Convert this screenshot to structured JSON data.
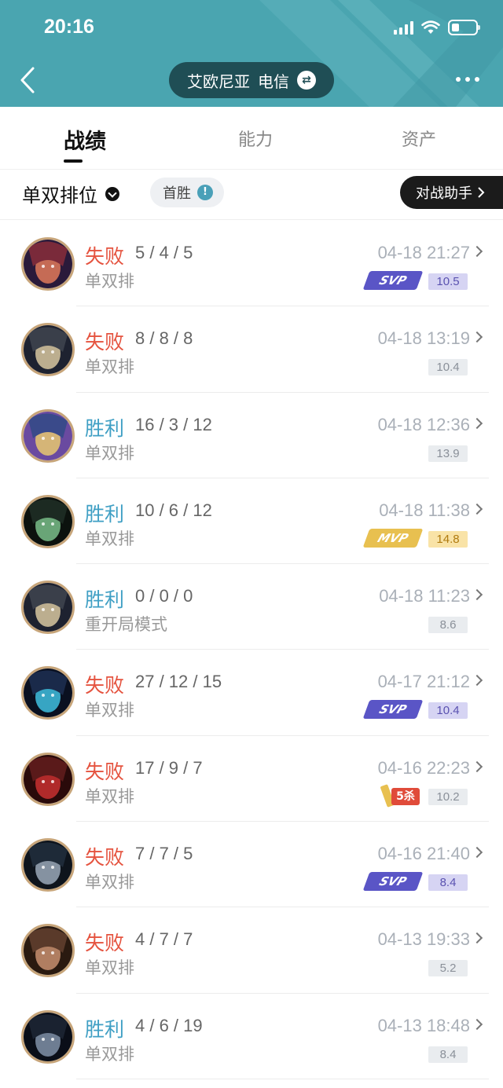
{
  "status_bar": {
    "time": "20:16"
  },
  "header": {
    "region": "艾欧尼亚",
    "isp": "电信"
  },
  "tabs": [
    {
      "label": "战绩",
      "active": true
    },
    {
      "label": "能力",
      "active": false
    },
    {
      "label": "资产",
      "active": false
    }
  ],
  "filter": {
    "queue": "单双排位",
    "first_win": "首胜",
    "assistant": "对战助手"
  },
  "colors": {
    "header_bg": "#4aa5b0",
    "lose": "#e5533f",
    "win": "#3f9fc4",
    "svp": "#5a55c6",
    "mvp": "#e8c050"
  },
  "matches": [
    {
      "result": "失败",
      "kda": "5 / 4 / 5",
      "mode": "单双排",
      "time": "04-18 21:27",
      "badge": "SVP",
      "score": "10.5",
      "avatar": "champion-portrait"
    },
    {
      "result": "失败",
      "kda": "8 / 8 / 8",
      "mode": "单双排",
      "time": "04-18 13:19",
      "badge": "",
      "score": "10.4",
      "avatar": "champion-portrait"
    },
    {
      "result": "胜利",
      "kda": "16 / 3 / 12",
      "mode": "单双排",
      "time": "04-18 12:36",
      "badge": "",
      "score": "13.9",
      "avatar": "champion-portrait"
    },
    {
      "result": "胜利",
      "kda": "10 / 6 / 12",
      "mode": "单双排",
      "time": "04-18 11:38",
      "badge": "MVP",
      "score": "14.8",
      "avatar": "champion-portrait"
    },
    {
      "result": "胜利",
      "kda": "0 / 0 / 0",
      "mode": "重开局模式",
      "time": "04-18 11:23",
      "badge": "",
      "score": "8.6",
      "avatar": "champion-portrait"
    },
    {
      "result": "失败",
      "kda": "27 / 12 / 15",
      "mode": "单双排",
      "time": "04-17 21:12",
      "badge": "SVP",
      "score": "10.4",
      "avatar": "champion-portrait"
    },
    {
      "result": "失败",
      "kda": "17 / 9 / 7",
      "mode": "单双排",
      "time": "04-16 22:23",
      "badge": "5杀",
      "score": "10.2",
      "avatar": "champion-portrait"
    },
    {
      "result": "失败",
      "kda": "7 / 7 / 5",
      "mode": "单双排",
      "time": "04-16 21:40",
      "badge": "SVP",
      "score": "8.4",
      "avatar": "champion-portrait"
    },
    {
      "result": "失败",
      "kda": "4 / 7 / 7",
      "mode": "单双排",
      "time": "04-13 19:33",
      "badge": "",
      "score": "5.2",
      "avatar": "champion-portrait"
    },
    {
      "result": "胜利",
      "kda": "4 / 6 / 19",
      "mode": "单双排",
      "time": "04-13 18:48",
      "badge": "",
      "score": "8.4",
      "avatar": "champion-portrait"
    }
  ]
}
